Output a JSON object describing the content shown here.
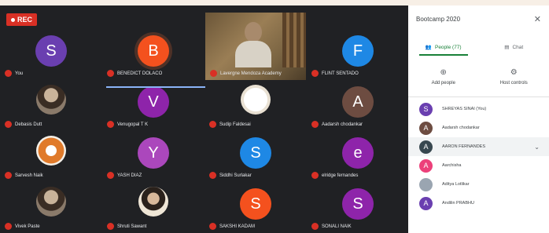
{
  "recording_label": "REC",
  "grid": [
    {
      "name": "You",
      "initial": "S",
      "color": "#6a3fb0"
    },
    {
      "name": "BENEDICT DOLACO",
      "initial": "B",
      "color": "#f4511e",
      "active": true
    },
    {
      "name": "Lavergne Mendoza Academy",
      "video": true
    },
    {
      "name": "FLINT SENTADO",
      "initial": "F",
      "color": "#1e88e5"
    },
    {
      "name": "Debasis Dutt",
      "photo": "man"
    },
    {
      "name": "Venugopal T K",
      "initial": "V",
      "color": "#8e24aa"
    },
    {
      "name": "Sudip Faldesai",
      "photo": "logo"
    },
    {
      "name": "Aadarsh chodankar",
      "initial": "A",
      "color": "#6d4c41"
    },
    {
      "name": "Sarvesh Naik",
      "photo": "fox"
    },
    {
      "name": "YASH DIAZ",
      "initial": "Y",
      "color": "#ab47bc"
    },
    {
      "name": "Siddhi Surlakar",
      "initial": "S",
      "color": "#1e88e5"
    },
    {
      "name": "elridge fernandes",
      "initial": "e",
      "color": "#8e24aa"
    },
    {
      "name": "Vivek Paste",
      "photo": "man"
    },
    {
      "name": "Shruti Sawant",
      "photo": "woman"
    },
    {
      "name": "SAKSHI KADAM",
      "initial": "S",
      "color": "#f4511e"
    },
    {
      "name": "SONALI NAIK",
      "initial": "S",
      "color": "#8e24aa"
    }
  ],
  "sidebar": {
    "title": "Bootcamp 2020",
    "tab_people": "People (77)",
    "tab_chat": "Chat",
    "add_people": "Add people",
    "host_controls": "Host controls",
    "people": [
      {
        "name": "SHREYAS SINAI (You)",
        "initial": "S",
        "color": "#6a3fb0"
      },
      {
        "name": "Aadarsh chodankar",
        "initial": "A",
        "color": "#6d4c41"
      },
      {
        "name": "AARON FERNANDES",
        "initial": "A",
        "color": "#37474f",
        "highlight": true
      },
      {
        "name": "Aarchisha",
        "initial": "A",
        "color": "#ec407a"
      },
      {
        "name": "Aditya Lotlikar",
        "initial": "",
        "color": "#9aa5b1"
      },
      {
        "name": "Andilin PRABHU",
        "initial": "A",
        "color": "#6a3fb0"
      }
    ]
  }
}
